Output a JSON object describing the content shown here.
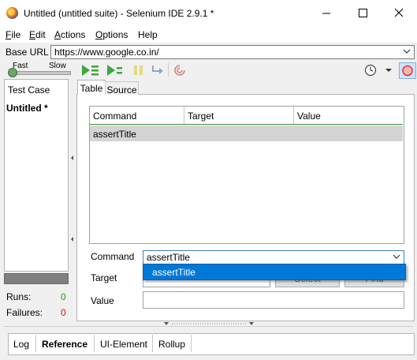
{
  "window": {
    "title": "Untitled (untitled suite) - Selenium IDE 2.9.1 *",
    "minimize_icon": "minimize-icon",
    "maximize_icon": "maximize-icon",
    "close_icon": "close-icon"
  },
  "menu": {
    "items": [
      {
        "label": "File",
        "underline": "F",
        "rest": "ile"
      },
      {
        "label": "Edit",
        "underline": "E",
        "rest": "dit"
      },
      {
        "label": "Actions",
        "underline": "A",
        "rest": "ctions"
      },
      {
        "label": "Options",
        "underline": "O",
        "rest": "ptions"
      },
      {
        "label": "Help",
        "underline": "",
        "rest": "Help"
      }
    ]
  },
  "base_url": {
    "label": "Base URL",
    "value": "https://www.google.co.in/"
  },
  "toolbar": {
    "speed_fast": "Fast",
    "speed_slow": "Slow",
    "icons": [
      "play-suite-icon",
      "play-test-icon",
      "pause-icon",
      "step-icon",
      "rollup-icon",
      "clock-icon",
      "record-icon"
    ]
  },
  "test_case_panel": {
    "header": "Test Case",
    "items": [
      "Untitled *"
    ],
    "runs_label": "Runs:",
    "runs_value": "0",
    "failures_label": "Failures:",
    "failures_value": "0",
    "colors": {
      "runs": "#1a9a1a",
      "failures": "#dd1111"
    }
  },
  "editor": {
    "tabs": [
      "Table",
      "Source"
    ],
    "active_tab": "Table",
    "columns": [
      "Command",
      "Target",
      "Value"
    ],
    "rows": [
      {
        "command": "assertTitle",
        "target": "",
        "value": ""
      }
    ],
    "command_label": "Command",
    "command_value": "assertTitle",
    "target_label": "Target",
    "target_value": "",
    "select_button": "Select",
    "find_button": "Find",
    "value_label": "Value",
    "value_value": "",
    "dropdown_options": [
      "assertTitle"
    ],
    "dropdown_highlight": "#0078d7"
  },
  "bottom": {
    "tabs": [
      "Log",
      "Reference",
      "UI-Element",
      "Rollup"
    ],
    "active_tab": "Reference"
  }
}
